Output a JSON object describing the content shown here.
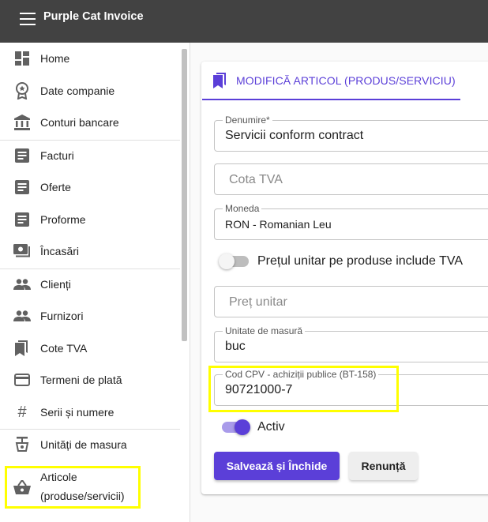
{
  "app": {
    "title": "Purple Cat Invoice"
  },
  "sidebar": {
    "items": [
      {
        "label": "Home",
        "icon": "dashboard-icon"
      },
      {
        "label": "Date companie",
        "icon": "badge-icon"
      },
      {
        "label": "Conturi bancare",
        "icon": "bank-icon"
      },
      {
        "label": "Facturi",
        "icon": "document-icon"
      },
      {
        "label": "Oferte",
        "icon": "document-icon"
      },
      {
        "label": "Proforme",
        "icon": "document-icon"
      },
      {
        "label": "Încasări",
        "icon": "payments-icon"
      },
      {
        "label": "Clienți",
        "icon": "people-icon"
      },
      {
        "label": "Furnizori",
        "icon": "people-icon"
      },
      {
        "label": "Cote TVA",
        "icon": "bookmarks-icon"
      },
      {
        "label": "Termeni de plată",
        "icon": "credit-card-icon"
      },
      {
        "label": "Serii și numere",
        "icon": "hash-icon"
      },
      {
        "label": "Unități de masura",
        "icon": "scale-icon"
      },
      {
        "label_line1": "Articole",
        "label_line2": "(produse/servicii)",
        "icon": "basket-icon"
      }
    ]
  },
  "form": {
    "title": "MODIFICĂ ARTICOL (PRODUS/SERVICIU)",
    "denumire": {
      "label": "Denumire*",
      "value": "Servicii conform contract"
    },
    "cota_tva": {
      "placeholder": "Cota TVA"
    },
    "moneda": {
      "label": "Moneda",
      "value": "RON - Romanian Leu"
    },
    "include_tva": {
      "label": "Prețul unitar pe produse include TVA",
      "on": false
    },
    "pret_unitar": {
      "placeholder": "Preț unitar"
    },
    "unitate": {
      "label": "Unitate de masură",
      "value": "buc"
    },
    "cod_cpv": {
      "label": "Cod CPV - achiziții publice (BT-158)",
      "value": "90721000-7"
    },
    "activ": {
      "label": "Activ",
      "on": true
    },
    "save_label": "Salvează și Închide",
    "cancel_label": "Renunță"
  },
  "colors": {
    "accent": "#5b3fd8",
    "topbar": "#424242",
    "highlight": "#ffff00"
  }
}
